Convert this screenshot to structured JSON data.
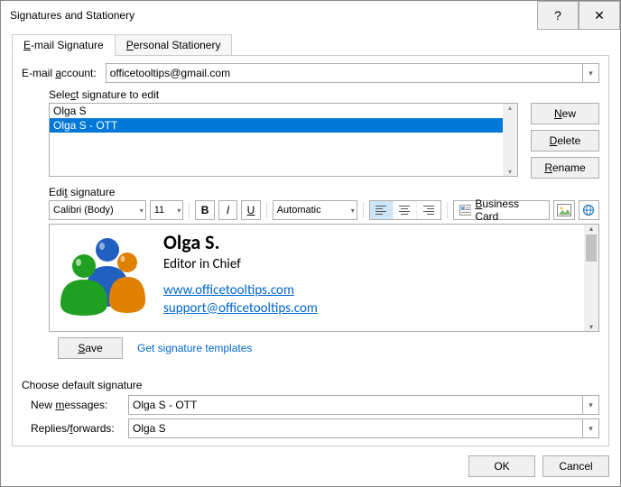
{
  "window": {
    "title": "Signatures and Stationery"
  },
  "tabs": {
    "email_signature": "E-mail Signature",
    "personal_stationery": "Personal Stationery"
  },
  "email_account": {
    "label_pre": "E-mail ",
    "label_u": "a",
    "label_post": "ccount:",
    "value": "officetooltips@gmail.com"
  },
  "select_sig": {
    "label_pre": "Sele",
    "label_u": "c",
    "label_post": "t signature to edit",
    "items": [
      {
        "label": "Olga S",
        "selected": false
      },
      {
        "label": "Olga S - OTT",
        "selected": true
      }
    ]
  },
  "buttons": {
    "new_pre": "",
    "new_u": "N",
    "new_post": "ew",
    "delete_pre": "",
    "delete_u": "D",
    "delete_post": "elete",
    "rename_pre": "",
    "rename_u": "R",
    "rename_post": "ename",
    "save_pre": "",
    "save_u": "S",
    "save_post": "ave",
    "ok": "OK",
    "cancel": "Cancel",
    "business_card_pre": "",
    "business_card_u": "B",
    "business_card_post": "usiness Card"
  },
  "edit_sig": {
    "label_pre": "Edi",
    "label_u": "t",
    "label_post": " signature"
  },
  "toolbar": {
    "font": "Calibri (Body)",
    "size": "11",
    "bold": "B",
    "italic": "I",
    "underline": "U",
    "color": "Automatic"
  },
  "signature": {
    "name": "Olga S.",
    "role": "Editor in Chief",
    "link1": "www.officetooltips.com",
    "link2": "support@officetooltips.com"
  },
  "templates_link": "Get signature templates",
  "defaults": {
    "label": "Choose default signature",
    "new_messages_label_pre": "New ",
    "new_messages_label_u": "m",
    "new_messages_label_post": "essages:",
    "new_messages_value": "Olga S - OTT",
    "replies_label_pre": "Replies/",
    "replies_label_u": "f",
    "replies_label_post": "orwards:",
    "replies_value": "Olga S"
  }
}
